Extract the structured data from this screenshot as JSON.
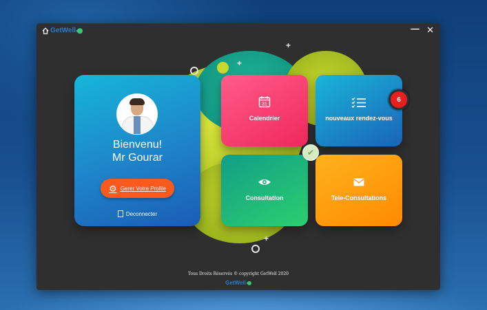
{
  "app": {
    "brand": "GetWell"
  },
  "window_controls": {
    "minimize": "—",
    "close": "✕"
  },
  "profile": {
    "greeting": "Bienvenu!",
    "name": "Mr Gourar",
    "manage_label": "Gerer Votre Profile",
    "logout_label": "Deconnecter"
  },
  "tiles": {
    "calendar": {
      "label": "Calendrier",
      "icon": "calendar-icon",
      "icon_text": "31",
      "color": "#f0275c"
    },
    "appointments": {
      "label": "nouveaux rendez-vous",
      "icon": "checklist-icon",
      "badge": "6",
      "color": "#1a63b8"
    },
    "consultation": {
      "label": "Consultation",
      "icon": "eye-icon",
      "color": "#2bcf6f"
    },
    "teleconsult": {
      "label": "Tele-Consultations",
      "icon": "envelope-icon",
      "color": "#ff8a00"
    }
  },
  "footer": {
    "copyright": "Tous Droits Réservés © copyright GetWell 2020",
    "brand": "GetWell"
  },
  "colors": {
    "window_bg": "#2f2f30",
    "accent_orange": "#fb5a1e",
    "badge_red": "#e81f1f",
    "blob_lime": "#c5d82c"
  }
}
